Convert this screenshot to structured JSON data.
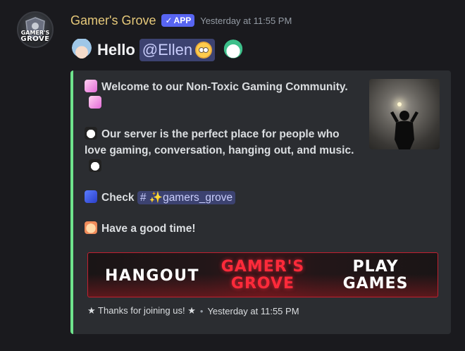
{
  "message": {
    "username": "Gamer's Grove",
    "badge_label": "APP",
    "badge_check": "✓",
    "timestamp": "Yesterday at 11:55 PM",
    "avatar_text_top": "GAMER'S",
    "avatar_text_bottom": "GROVE",
    "content": {
      "hello": "Hello",
      "mention": "@Ellen"
    }
  },
  "embed": {
    "accent_color": "#6fe38c",
    "line1": "Welcome to our Non-Toxic Gaming Community.",
    "line2": "Our server is the perfect place for people who love gaming, conversation, hanging out, and music.",
    "check_label": "Check",
    "channel": "# ✨gamers_grove",
    "line4": "Have a good time!",
    "banner": {
      "left": "HANGOUT",
      "middle_top": "GAMER'S",
      "middle_bottom": "GROVE",
      "right_top": "PLAY",
      "right_bottom": "GAMES"
    },
    "footer_text": "★ Thanks for joining us! ★",
    "footer_separator": "•",
    "footer_timestamp": "Yesterday at 11:55 PM"
  },
  "colors": {
    "background": "#1a1a1e",
    "username": "#e6c97a",
    "badge": "#5865f2",
    "mention_bg": "#3c4270",
    "banner_red": "#ff2a3a"
  }
}
